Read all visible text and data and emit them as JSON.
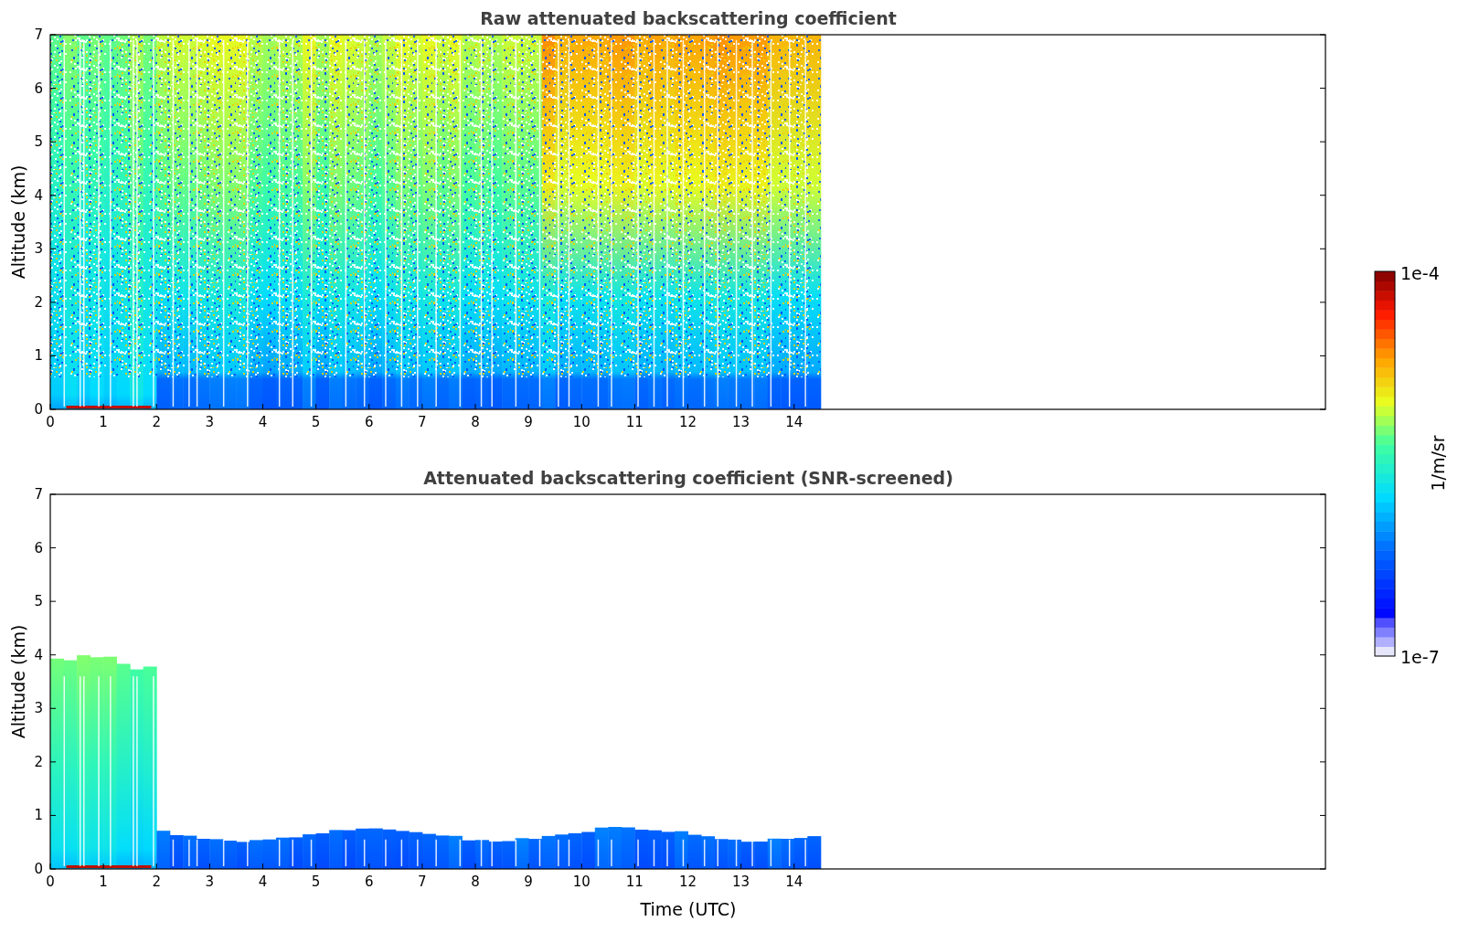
{
  "panels": [
    {
      "kind": "raw",
      "title": "Raw attenuated backscattering coefficient",
      "ylabel": "Altitude (km)",
      "yticks": [
        "7",
        "6",
        "5",
        "4",
        "3",
        "2",
        "1",
        "0"
      ],
      "xticks": [
        "0",
        "1",
        "2",
        "3",
        "4",
        "5",
        "6",
        "7",
        "8",
        "9",
        "10",
        "11",
        "12",
        "13",
        "14"
      ]
    },
    {
      "kind": "screened",
      "title": "Attenuated backscattering coefficient (SNR-screened)",
      "ylabel": "Altitude (km)",
      "yticks": [
        "7",
        "6",
        "5",
        "4",
        "3",
        "2",
        "1",
        "0"
      ],
      "xticks": [
        "0",
        "1",
        "2",
        "3",
        "4",
        "5",
        "6",
        "7",
        "8",
        "9",
        "10",
        "11",
        "12",
        "13",
        "14"
      ],
      "xlabel": "Time (UTC)"
    }
  ],
  "colorbar": {
    "max_label": "1e-4",
    "min_label": "1e-7",
    "unit": "1/m/sr"
  }
}
